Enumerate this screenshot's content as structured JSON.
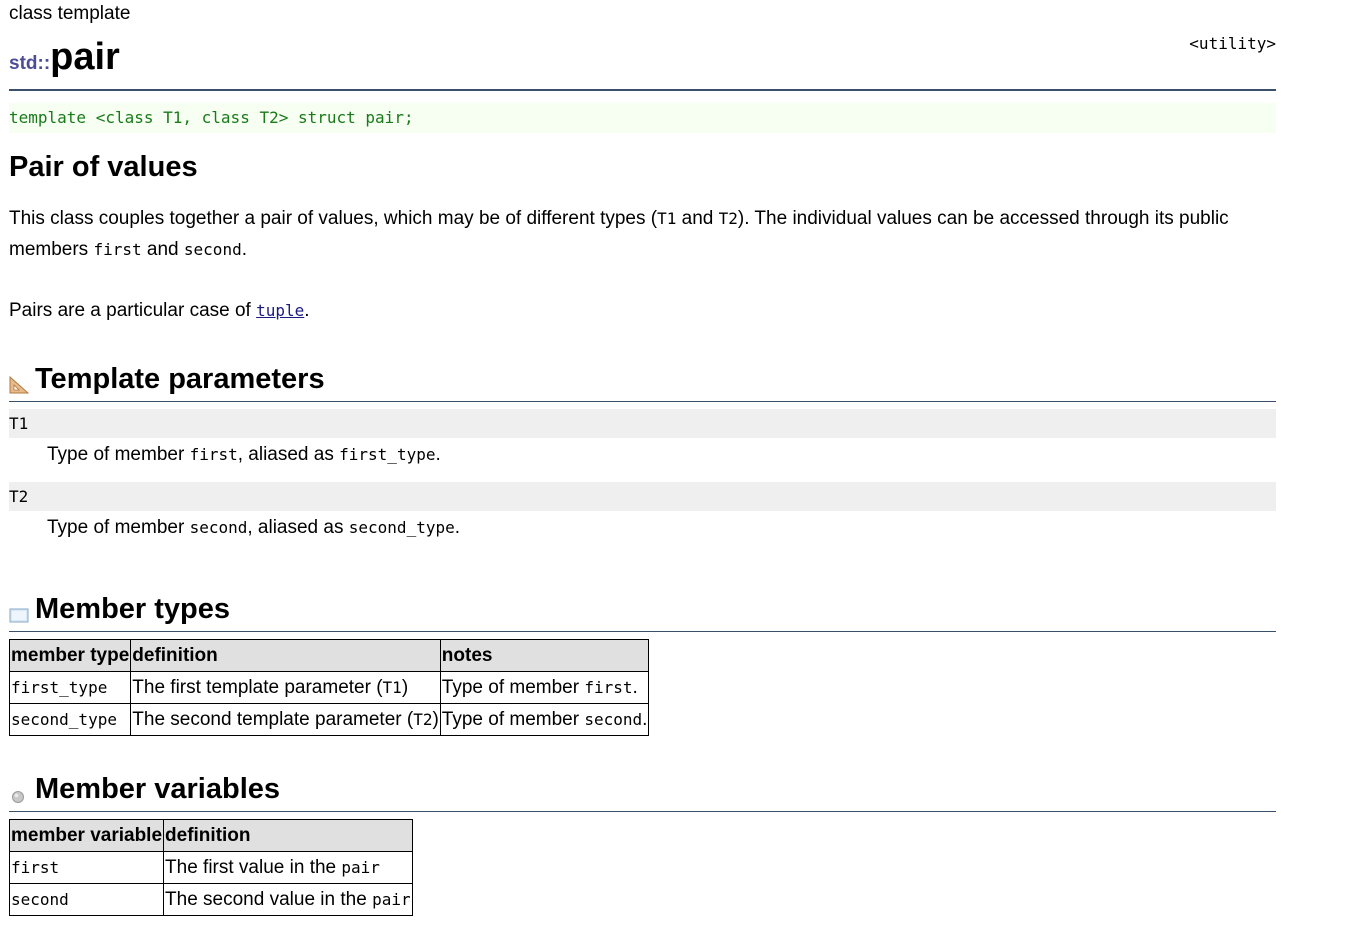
{
  "header": {
    "kind": "class template",
    "namespace": "std::",
    "name": "pair",
    "header_file": "<utility>"
  },
  "declaration": "template <class T1, class T2> struct pair;",
  "description": {
    "title": "Pair of values",
    "p1": {
      "a": "This class couples together a pair of values, which may be of different types (",
      "t1": "T1",
      "b": " and ",
      "t2": "T2",
      "c": "). The individual values can be accessed through its public members ",
      "first": "first",
      "d": " and ",
      "second": "second",
      "e": "."
    },
    "p2": {
      "a": "Pairs are a particular case of ",
      "link": "tuple",
      "b": "."
    }
  },
  "template_params": {
    "title": "Template parameters",
    "icon": "template-params-icon",
    "items": [
      {
        "term": "T1",
        "def_a": "Type of member ",
        "member": "first",
        "def_b": ", aliased as ",
        "alias": "first_type",
        "def_c": "."
      },
      {
        "term": "T2",
        "def_a": "Type of member ",
        "member": "second",
        "def_b": ", aliased as ",
        "alias": "second_type",
        "def_c": "."
      }
    ]
  },
  "member_types": {
    "title": "Member types",
    "icon": "member-types-icon",
    "headers": [
      "member type",
      "definition",
      "notes"
    ],
    "rows": [
      {
        "type": "first_type",
        "def_a": "The first template parameter (",
        "param": "T1",
        "def_b": ")",
        "note_a": "Type of member ",
        "member": "first",
        "note_b": "."
      },
      {
        "type": "second_type",
        "def_a": "The second template parameter (",
        "param": "T2",
        "def_b": ")",
        "note_a": "Type of member ",
        "member": "second",
        "note_b": "."
      }
    ]
  },
  "member_variables": {
    "title": "Member variables",
    "icon": "member-variables-icon",
    "headers": [
      "member variable",
      "definition"
    ],
    "rows": [
      {
        "name": "first",
        "def": "The first value in the ",
        "cls": "pair"
      },
      {
        "name": "second",
        "def": "The second value in the ",
        "cls": "pair"
      }
    ]
  },
  "colors": {
    "namespace": "#4c4c99",
    "declaration_text": "#1a7a1a",
    "declaration_bg": "#f6fff2",
    "rule": "#3a4f6a",
    "link": "#1a1a80",
    "param_term_bg": "#efefef",
    "table_header_bg": "#e0e0e0"
  }
}
